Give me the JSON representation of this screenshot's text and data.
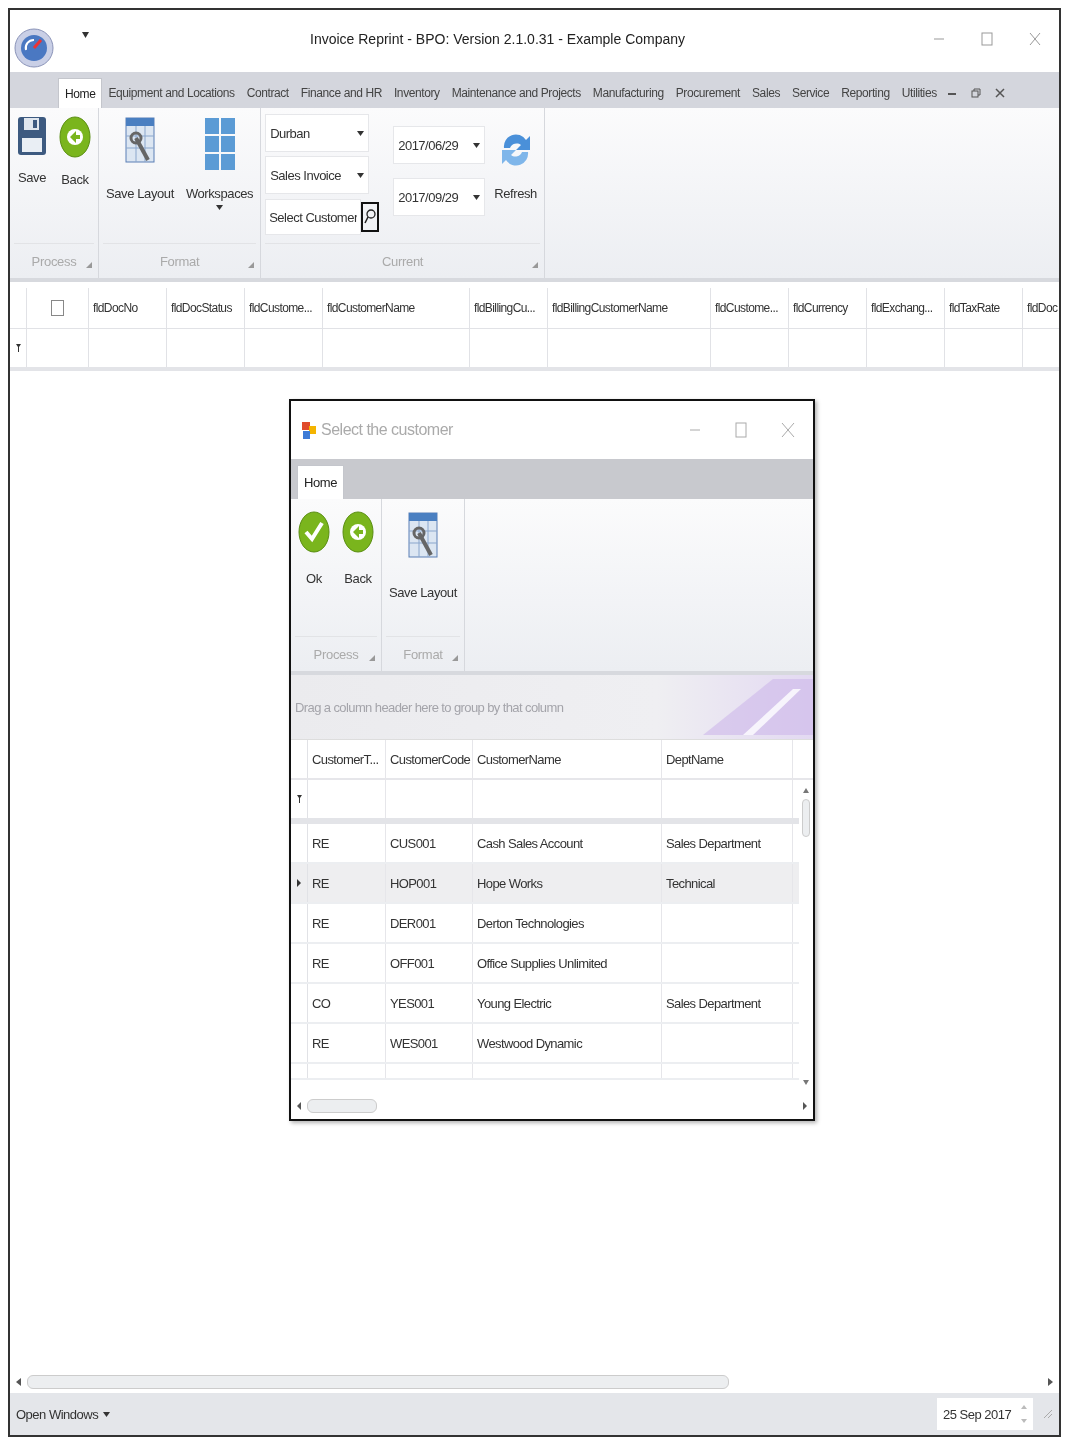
{
  "window": {
    "title": "Invoice Reprint - BPO: Version 2.1.0.31 - Example Company"
  },
  "ribbon_tabs": [
    {
      "label": "Home",
      "selected": true
    },
    {
      "label": "Equipment and Locations",
      "selected": false
    },
    {
      "label": "Contract",
      "selected": false
    },
    {
      "label": "Finance and HR",
      "selected": false
    },
    {
      "label": "Inventory",
      "selected": false
    },
    {
      "label": "Maintenance and Projects",
      "selected": false
    },
    {
      "label": "Manufacturing",
      "selected": false
    },
    {
      "label": "Procurement",
      "selected": false
    },
    {
      "label": "Sales",
      "selected": false
    },
    {
      "label": "Service",
      "selected": false
    },
    {
      "label": "Reporting",
      "selected": false
    },
    {
      "label": "Utilities",
      "selected": false
    }
  ],
  "ribbon": {
    "groups": [
      {
        "label": "Process",
        "buttons": [
          {
            "label": "Save"
          },
          {
            "label": "Back"
          }
        ]
      },
      {
        "label": "Format",
        "buttons": [
          {
            "label": "Save Layout"
          },
          {
            "label": "Workspaces",
            "dropdown": true
          }
        ]
      },
      {
        "label": "Current",
        "combos": [
          {
            "value": "Durban"
          },
          {
            "value": "Sales Invoice"
          }
        ],
        "search": {
          "placeholder": "Select Customer"
        },
        "dates": [
          {
            "value": "2017/06/29"
          },
          {
            "value": "2017/09/29"
          }
        ],
        "buttons": [
          {
            "label": "Refresh"
          }
        ]
      }
    ]
  },
  "grid": {
    "select_all_checked": false,
    "columns": [
      "fldDocNo",
      "fldDocStatus",
      "fldCustome...",
      "fldCustomerName",
      "fldBillingCu...",
      "fldBillingCustomerName",
      "fldCustome...",
      "fldCurrency",
      "fldExchang...",
      "fldTaxRate",
      "fldDoc"
    ]
  },
  "dialog": {
    "title": "Select the customer",
    "tabs": [
      {
        "label": "Home",
        "selected": true
      }
    ],
    "groups": [
      {
        "label": "Process",
        "buttons": [
          {
            "label": "Ok"
          },
          {
            "label": "Back"
          }
        ]
      },
      {
        "label": "Format",
        "buttons": [
          {
            "label": "Save Layout"
          }
        ]
      }
    ],
    "group_panel": "Drag a column header here to group by that column",
    "columns": [
      "CustomerT...",
      "CustomerCode",
      "CustomerName",
      "DeptName"
    ],
    "rows": [
      {
        "cells": [
          "RE",
          "CUS001",
          "Cash Sales Account",
          "Sales Department"
        ],
        "selected": false
      },
      {
        "cells": [
          "RE",
          "HOP001",
          "Hope Works",
          "Technical"
        ],
        "selected": true
      },
      {
        "cells": [
          "RE",
          "DER001",
          "Derton Technologies",
          ""
        ],
        "selected": false
      },
      {
        "cells": [
          "RE",
          "OFF001",
          "Office Supplies Unlimited",
          ""
        ],
        "selected": false
      },
      {
        "cells": [
          "CO",
          "YES001",
          "Young Electric",
          "Sales Department"
        ],
        "selected": false
      },
      {
        "cells": [
          "RE",
          "WES001",
          "Westwood Dynamic",
          ""
        ],
        "selected": false
      }
    ]
  },
  "status_bar": {
    "open_windows": "Open Windows",
    "date": "25 Sep 2017"
  }
}
